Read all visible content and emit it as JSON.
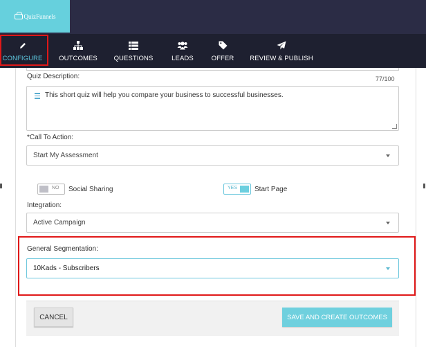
{
  "brand": {
    "logo_text": "QuizFunnels"
  },
  "nav": {
    "items": [
      {
        "label": "CONFIGURE",
        "icon": "pencil-icon",
        "active": true
      },
      {
        "label": "OUTCOMES",
        "icon": "sitemap-icon"
      },
      {
        "label": "QUESTIONS",
        "icon": "list-icon"
      },
      {
        "label": "LEADS",
        "icon": "users-icon"
      },
      {
        "label": "OFFER",
        "icon": "tag-icon"
      },
      {
        "label": "REVIEW & PUBLISH",
        "icon": "paper-plane-icon"
      }
    ]
  },
  "form": {
    "quiz_description": {
      "label": "Quiz Description:",
      "counter": "77/100",
      "value": "This short quiz will help you compare your business to successful businesses."
    },
    "call_to_action": {
      "label": "*Call To Action:",
      "value": "Start My Assessment"
    },
    "social_sharing": {
      "label": "Social Sharing",
      "state": "NO"
    },
    "start_page": {
      "label": "Start Page",
      "state": "YES"
    },
    "integration": {
      "label": "Integration:",
      "value": "Active Campaign"
    },
    "general_segmentation": {
      "label": "General Segmentation:",
      "value": "10Kads - Subscribers"
    }
  },
  "footer": {
    "cancel_label": "CANCEL",
    "save_label": "SAVE AND CREATE OUTCOMES"
  },
  "colors": {
    "header_bg": "#2b2c45",
    "nav_bg": "#1e2030",
    "accent": "#6fd0de",
    "highlight_border": "#e01818"
  }
}
